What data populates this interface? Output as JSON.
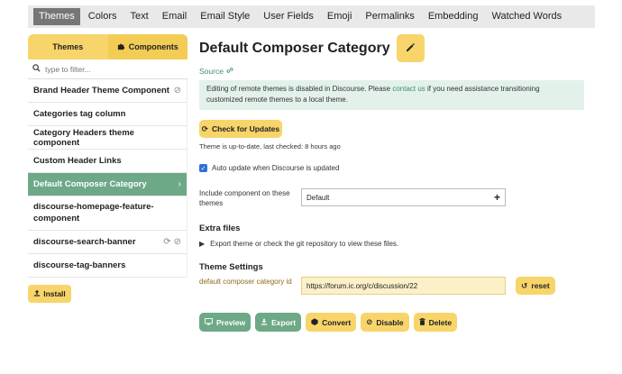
{
  "topnav": {
    "tabs": [
      "Themes",
      "Colors",
      "Text",
      "Email",
      "Email Style",
      "User Fields",
      "Emoji",
      "Permalinks",
      "Embedding",
      "Watched Words"
    ],
    "active": "Themes"
  },
  "sidebar": {
    "themes_tab": "Themes",
    "components_tab": "Components",
    "filter_placeholder": "type to filter...",
    "items": [
      {
        "label": "Brand Header Theme Component",
        "icons": [
          "ban-icon"
        ]
      },
      {
        "label": "Categories tag column",
        "icons": []
      },
      {
        "label": "Category Headers theme component",
        "icons": []
      },
      {
        "label": "Custom Header Links",
        "icons": []
      },
      {
        "label": "Default Composer Category",
        "icons": [
          "chevron-right-icon"
        ],
        "selected": true
      },
      {
        "label": "discourse-homepage-feature-component",
        "icons": []
      },
      {
        "label": "discourse-search-banner",
        "icons": [
          "sync-icon",
          "ban-icon"
        ]
      },
      {
        "label": "discourse-tag-banners",
        "icons": []
      }
    ],
    "install_label": "Install"
  },
  "main": {
    "title": "Default Composer Category",
    "source_label": "Source",
    "notice_before": "Editing of remote themes is disabled in Discourse. Please ",
    "notice_link": "contact us",
    "notice_after": " if you need assistance transitioning customized remote themes to a local theme.",
    "check_updates_label": "Check for Updates",
    "uptodate_text": "Theme is up-to-date, last checked: 8 hours ago",
    "auto_update_label": "Auto update when Discourse is updated",
    "auto_update_checked": true,
    "include_label": "Include component on these themes",
    "include_value": "Default",
    "extra_files_heading": "Extra files",
    "export_text": "Export theme or check the git repository to view these files.",
    "settings_heading": "Theme Settings",
    "setting_label": "default composer category id",
    "setting_value": "https://forum.ic.org/c/discussion/22",
    "reset_label": "reset",
    "actions": {
      "preview": "Preview",
      "export": "Export",
      "convert": "Convert",
      "disable": "Disable",
      "delete": "Delete"
    }
  },
  "colors": {
    "accent_yellow": "#f7d56a",
    "accent_green": "#6da986",
    "notice_bg": "#e3f1eb",
    "link": "#3f8f6e"
  }
}
